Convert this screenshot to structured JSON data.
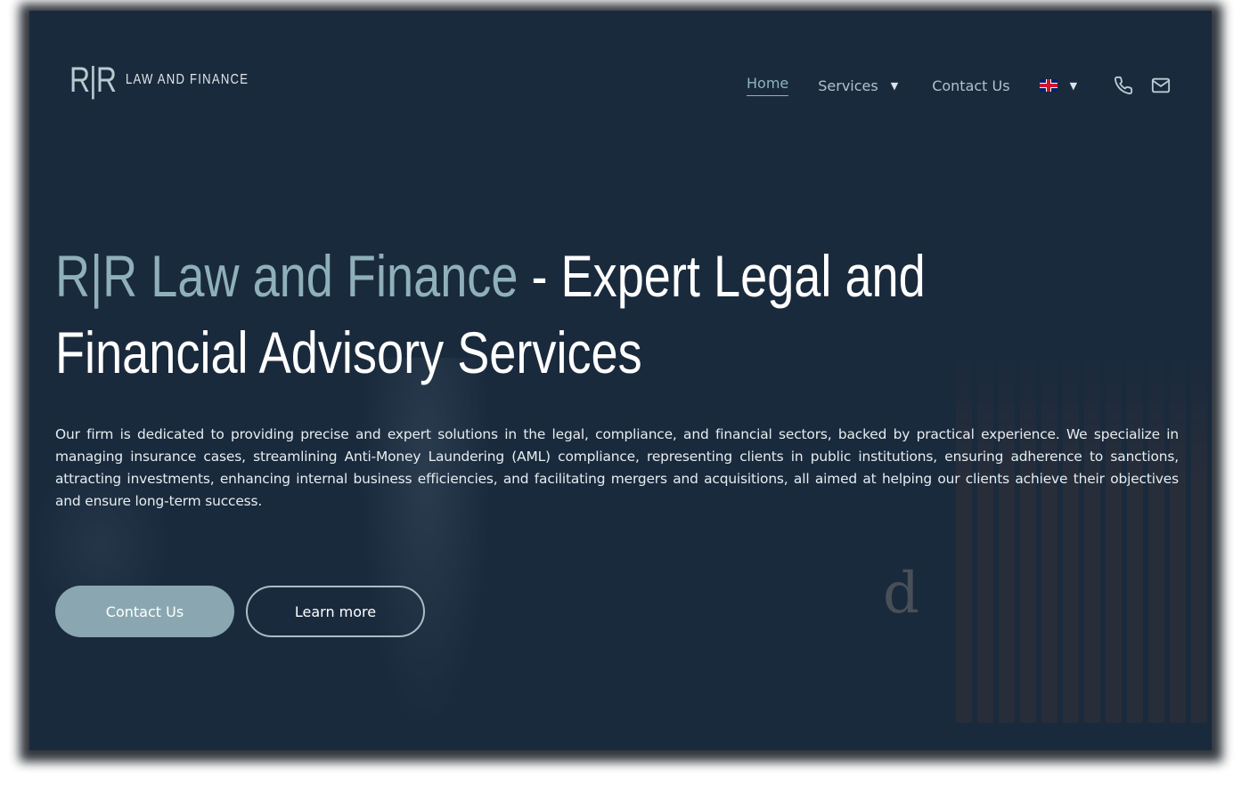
{
  "brand": {
    "logo_mark": "R|R",
    "logo_text": "LAW AND FINANCE"
  },
  "nav": {
    "home": "Home",
    "services": "Services",
    "contact": "Contact Us",
    "language_icon": "uk-flag-icon",
    "phone_icon": "phone-icon",
    "mail_icon": "mail-icon"
  },
  "hero": {
    "title_accent": "R|R Law and Finance",
    "title_rest": " - Expert Legal and Financial Advisory Services",
    "description": "Our firm is dedicated to providing precise and expert solutions in the legal, compliance, and financial sectors, backed by practical experience. We specialize in managing insurance cases, streamlining Anti-Money Laundering (AML) compliance, representing clients in public institutions, ensuring adherence to sanctions, attracting investments, enhancing internal business efficiencies, and facilitating mergers and acquisitions, all aimed at helping our clients achieve their objectives and ensure long-term success.",
    "primary_button": "Contact Us",
    "secondary_button": "Learn more",
    "background_letter": "d"
  },
  "colors": {
    "background": "#1a2a3d",
    "accent": "#8fb0ba",
    "button_primary": "#8aa7b1",
    "text": "#ffffff"
  },
  "side_tab_icon": "scissors-icon"
}
